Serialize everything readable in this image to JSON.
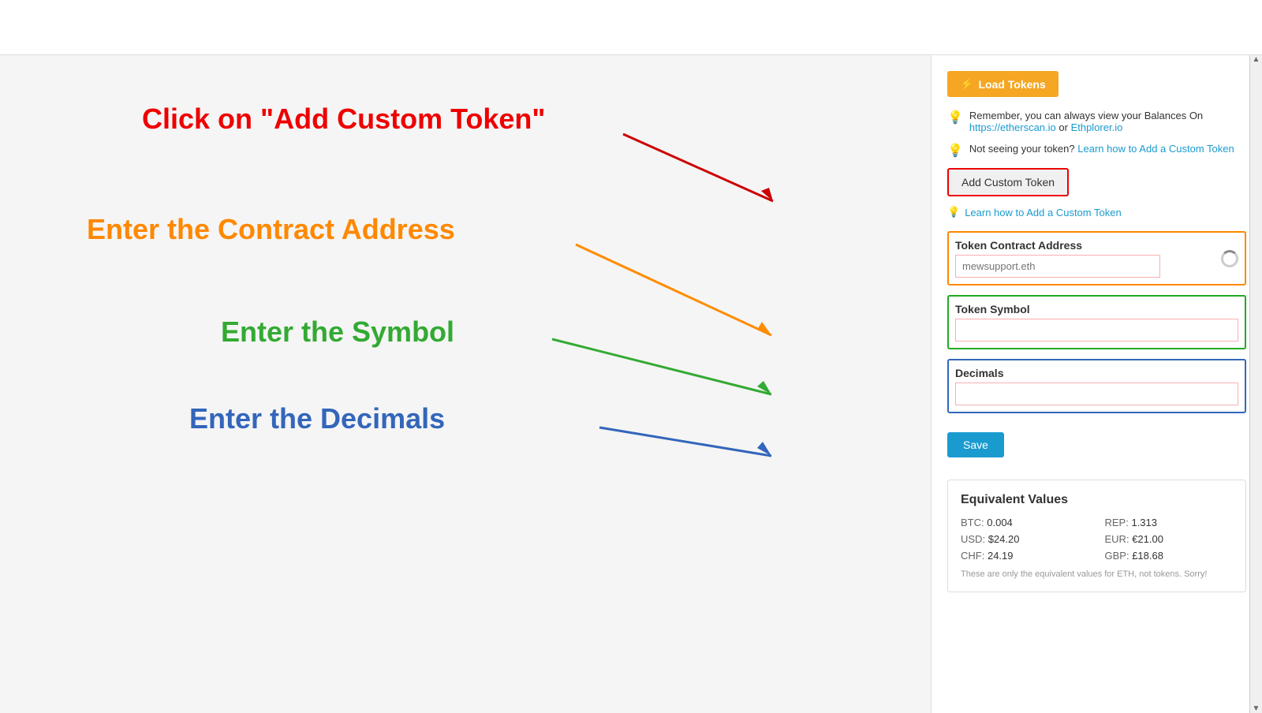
{
  "topbar": {
    "title": ""
  },
  "left": {
    "annotation_red": "Click on \"Add Custom Token\"",
    "annotation_orange": "Enter the Contract Address",
    "annotation_green": "Enter the Symbol",
    "annotation_blue": "Enter the Decimals"
  },
  "right": {
    "load_tokens_btn": "Load Tokens",
    "info1": "Remember, you can always view your Balances On",
    "info1_link1": "https://etherscan.io",
    "info1_link1_sep": " or ",
    "info1_link2": "Ethplorer.io",
    "info2_prefix": "Not seeing your token?",
    "info2_link": "Learn how to Add a Custom Token",
    "add_custom_token_btn": "Add Custom Token",
    "learn_link": "Learn how to Add a Custom Token",
    "contract_label": "Token Contract Address",
    "contract_placeholder": "mewsupport.eth",
    "symbol_label": "Token Symbol",
    "symbol_placeholder": "",
    "decimals_label": "Decimals",
    "decimals_placeholder": "",
    "save_btn": "Save",
    "equiv_title": "Equivalent Values",
    "btc_label": "BTC:",
    "btc_value": "0.004",
    "rep_label": "REP:",
    "rep_value": "1.313",
    "usd_label": "USD:",
    "usd_value": "$24.20",
    "eur_label": "EUR:",
    "eur_value": "€21.00",
    "chf_label": "CHF:",
    "chf_value": "24.19",
    "gbp_label": "GBP:",
    "gbp_value": "£18.68",
    "equiv_note": "These are only the equivalent values for ETH, not tokens. Sorry!"
  }
}
